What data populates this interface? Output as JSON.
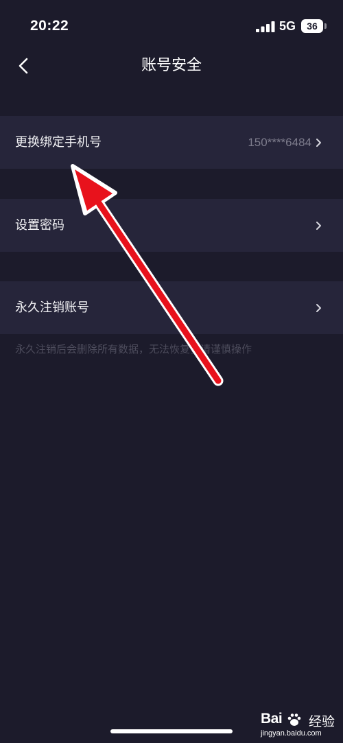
{
  "status_bar": {
    "time": "20:22",
    "network": "5G",
    "battery": "36",
    "signal_icon": "signal-bars-icon"
  },
  "nav": {
    "title": "账号安全",
    "back_icon": "chevron-left-icon"
  },
  "rows": [
    {
      "label": "更换绑定手机号",
      "value": "150****6484"
    },
    {
      "label": "设置密码",
      "value": ""
    },
    {
      "label": "永久注销账号",
      "value": ""
    }
  ],
  "hint": "永久注销后会删除所有数据，无法恢复，请谨慎操作",
  "watermark": {
    "brand": "Bai",
    "product": "经验",
    "domain": "jingyan.baidu.com"
  },
  "colors": {
    "background": "#1c1b2b",
    "row_background": "#26253a",
    "annotation_arrow": "#e8121c"
  }
}
